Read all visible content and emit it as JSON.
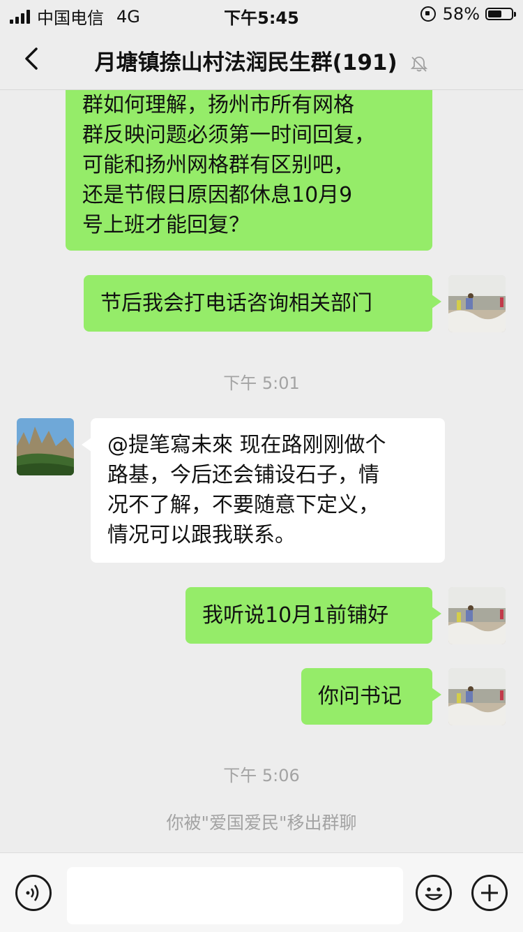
{
  "status_bar": {
    "carrier": "中国电信",
    "network": "4G",
    "time": "下午5:45",
    "battery": "58%",
    "battery_level": 0.58
  },
  "header": {
    "title": "月塘镇捺山村法润民生群(191)"
  },
  "messages": [
    {
      "side": "right",
      "lines": [
        "群如何理解，扬州市所有网格",
        "群反映问题必须第一时间回复，",
        "可能和扬州网格群有区别吧，",
        "还是节假日原因都休息10月9",
        "号上班才能回复？"
      ]
    },
    {
      "side": "right",
      "text": "节后我会打电话咨询相关部门"
    },
    {
      "type": "time",
      "text": "下午 5:01"
    },
    {
      "side": "left",
      "lines": [
        "@提笔寫未來 现在路刚刚做个",
        "路基，今后还会铺设石子，情",
        "况不了解，不要随意下定义，",
        "情况可以跟我联系。"
      ]
    },
    {
      "side": "right",
      "text": "我听说10月1前铺好"
    },
    {
      "side": "right",
      "text": "你问书记"
    },
    {
      "type": "time",
      "text": "下午 5:06"
    },
    {
      "type": "system",
      "text": "你被\"爱国爱民\"移出群聊"
    }
  ],
  "input_bar": {
    "voice_icon": "voice-icon",
    "emoji_icon": "emoji-icon",
    "plus_icon": "plus-icon",
    "text_value": ""
  },
  "icons": {
    "back": "chevron-left-icon",
    "mute": "bell-mute-icon"
  },
  "colors": {
    "self_bubble": "#95ec69",
    "other_bubble": "#ffffff",
    "background": "#ededed"
  }
}
